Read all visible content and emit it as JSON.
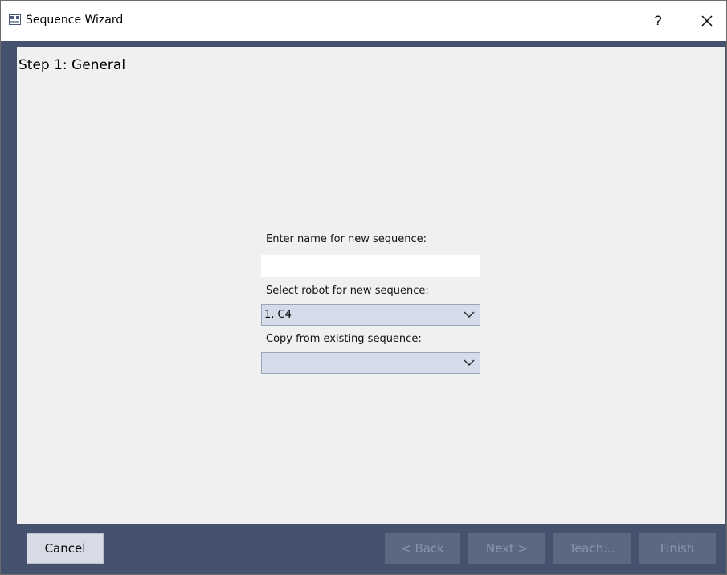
{
  "window": {
    "title": "Sequence Wizard",
    "help_label": "?",
    "app_icon": "wizard-app-icon",
    "close_icon": "close-icon"
  },
  "step": {
    "title": "Step 1: General"
  },
  "form": {
    "name_label": "Enter name for new sequence:",
    "name_value": "",
    "robot_label": "Select robot for new sequence:",
    "robot_value": "1, C4",
    "copy_label": "Copy from existing sequence:",
    "copy_value": ""
  },
  "buttons": {
    "cancel": "Cancel",
    "back": "< Back",
    "next": "Next >",
    "teach": "Teach...",
    "finish": "Finish"
  },
  "colors": {
    "frame": "#44526d",
    "content": "#f0f0f0",
    "combo_bg": "#d6dbe9",
    "disabled_button": "#5b6882"
  }
}
